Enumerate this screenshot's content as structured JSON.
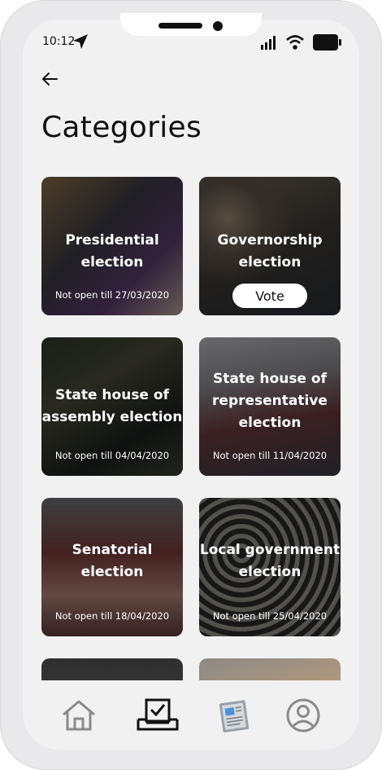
{
  "status_bar": {
    "time": "10:12"
  },
  "page": {
    "title": "Categories"
  },
  "categories": [
    {
      "label_line1": "Presidential",
      "label_line2": "election",
      "status": "Not open till 27/03/2020"
    },
    {
      "label_line1": "Governorship",
      "label_line2": "election",
      "action": "Vote"
    },
    {
      "label_line1": "State house of",
      "label_line2": "assembly election",
      "status": "Not open till 04/04/2020"
    },
    {
      "label_line1": "State house of",
      "label_line2": "representative",
      "label_line3": "election",
      "status": "Not open till 11/04/2020"
    },
    {
      "label_line1": "Senatorial",
      "label_line2": "election",
      "status": "Not open till 18/04/2020"
    },
    {
      "label_line1": "Local government",
      "label_line2": "election",
      "status": "Not open till 25/04/2020"
    }
  ],
  "icons": {
    "back": "arrow-left-icon",
    "nav": [
      "home-icon",
      "vote-box-icon",
      "newspaper-icon",
      "profile-icon"
    ]
  },
  "colors": {
    "screen_bg": "#f1f1f2",
    "icon_gray": "#8a8a8a",
    "active": "#111111"
  }
}
